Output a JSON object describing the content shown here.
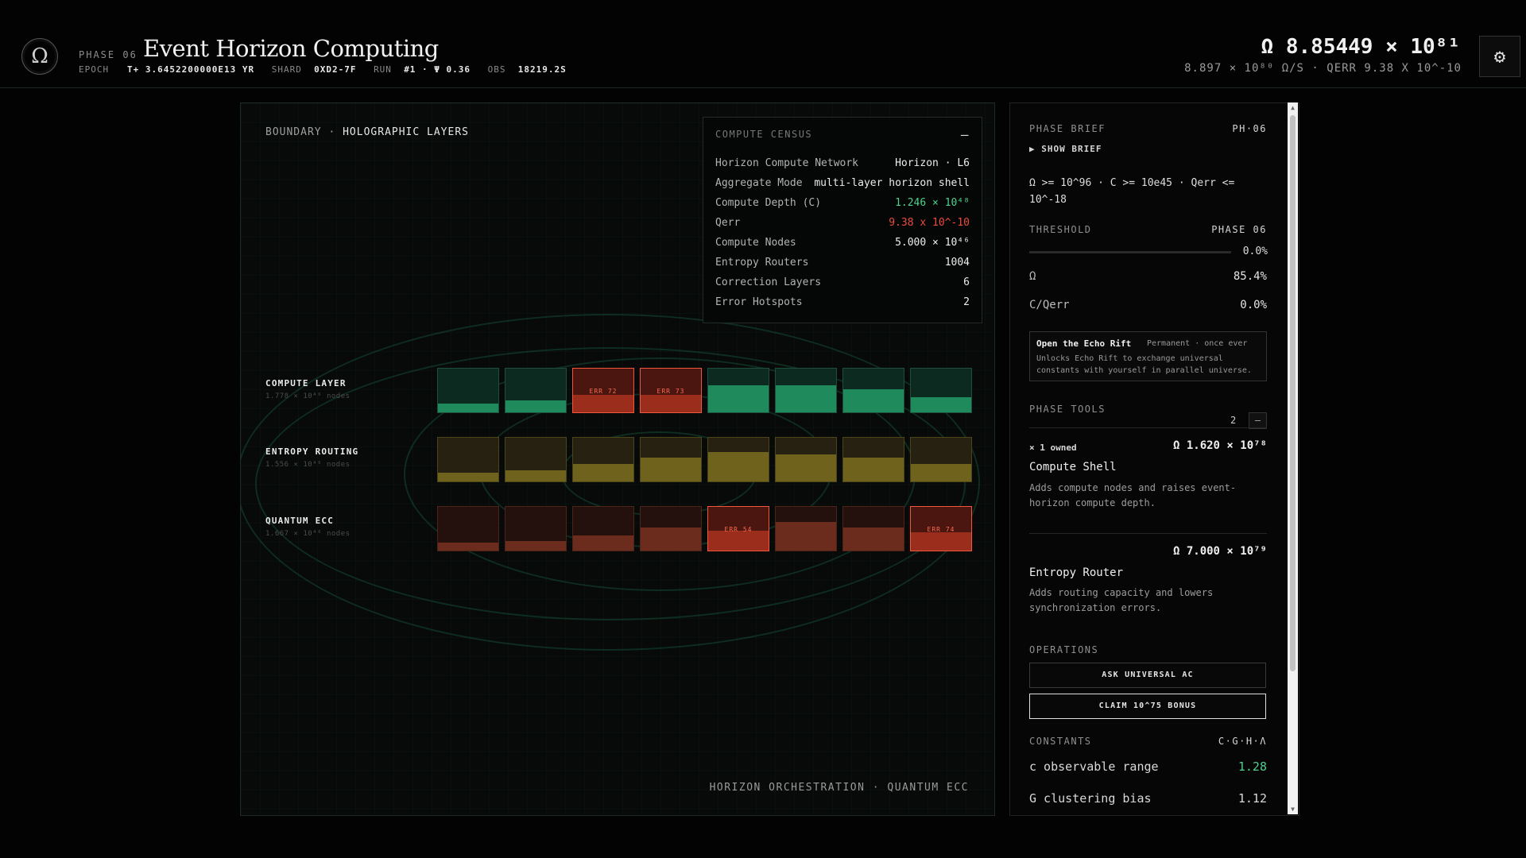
{
  "header": {
    "logo_glyph": "Ω",
    "phase_label": "PHASE 06",
    "title": "Event Horizon Computing",
    "meta": {
      "epoch_label": "EPOCH",
      "epoch_value": "T+ 3.6452200000E13 YR",
      "shard_label": "SHARD",
      "shard_value": "0XD2-7F",
      "run_label": "RUN",
      "run_value": "#1 · Ψ 0.36",
      "obs_label": "OBS",
      "obs_value": "18219.2S"
    },
    "omega_total": "Ω 8.85449 × 10⁸¹",
    "omega_rate": "8.897 × 10⁸⁰ Ω/S · QERR 9.38 X 10^-10",
    "settings_icon": "gear-icon"
  },
  "main": {
    "boundary_prefix": "BOUNDARY ·",
    "boundary_title": "HOLOGRAPHIC LAYERS",
    "footer": "HORIZON ORCHESTRATION · QUANTUM ECC",
    "census": {
      "title": "COMPUTE CENSUS",
      "collapse": "–",
      "rows": [
        {
          "k": "Horizon Compute Network",
          "v": "Horizon · L6"
        },
        {
          "k": "Aggregate Mode",
          "v": "multi-layer horizon shell"
        },
        {
          "k": "Compute Depth (C)",
          "v": "1.246 × 10⁴⁸"
        },
        {
          "k": "Qerr",
          "v": "9.38 x 10^-10"
        },
        {
          "k": "Compute Nodes",
          "v": "5.000 × 10⁴⁶"
        },
        {
          "k": "Entropy Routers",
          "v": "1004"
        },
        {
          "k": "Correction Layers",
          "v": "6"
        },
        {
          "k": "Error Hotspots",
          "v": "2"
        }
      ]
    },
    "layers": [
      {
        "name": "COMPUTE LAYER",
        "sub": "1.778 × 10⁴⁶ nodes",
        "color": "#1f8a5b",
        "cells": [
          {
            "level": 0.2,
            "err": ""
          },
          {
            "level": 0.28,
            "err": ""
          },
          {
            "level": 0.4,
            "err": "ERR 72"
          },
          {
            "level": 0.4,
            "err": "ERR 73"
          },
          {
            "level": 0.62,
            "err": ""
          },
          {
            "level": 0.62,
            "err": ""
          },
          {
            "level": 0.52,
            "err": ""
          },
          {
            "level": 0.35,
            "err": ""
          }
        ]
      },
      {
        "name": "ENTROPY ROUTING",
        "sub": "1.556 × 10⁴⁶ nodes",
        "color": "#6f621d",
        "cells": [
          {
            "level": 0.2,
            "err": ""
          },
          {
            "level": 0.26,
            "err": ""
          },
          {
            "level": 0.4,
            "err": ""
          },
          {
            "level": 0.55,
            "err": ""
          },
          {
            "level": 0.68,
            "err": ""
          },
          {
            "level": 0.62,
            "err": ""
          },
          {
            "level": 0.55,
            "err": ""
          },
          {
            "level": 0.4,
            "err": ""
          }
        ]
      },
      {
        "name": "QUANTUM ECC",
        "sub": "1.667 × 10⁴⁶ nodes",
        "color": "#6b2b1d",
        "cells": [
          {
            "level": 0.18,
            "err": ""
          },
          {
            "level": 0.22,
            "err": ""
          },
          {
            "level": 0.35,
            "err": ""
          },
          {
            "level": 0.52,
            "err": ""
          },
          {
            "level": 0.45,
            "err": "ERR 54"
          },
          {
            "level": 0.65,
            "err": ""
          },
          {
            "level": 0.52,
            "err": ""
          },
          {
            "level": 0.42,
            "err": "ERR 74"
          }
        ]
      }
    ]
  },
  "side": {
    "brief_title": "PHASE BRIEF",
    "brief_code": "PH·06",
    "show_brief": "▶ SHOW BRIEF",
    "brief_text": "Ω >= 10^96 · C >= 10e45 · Qerr <= 10^-18",
    "threshold_label": "THRESHOLD",
    "threshold_phase": "PHASE 06",
    "threshold_pct": "0.0%",
    "threshold_progress": 0.0,
    "omega_label": "Ω",
    "omega_pct": "85.4%",
    "cq_label": "C/Qerr",
    "cq_pct": "0.0%",
    "echo": {
      "title": "Open the Echo Rift",
      "tag": "Permanent · once ever",
      "desc": "Unlocks Echo Rift to exchange universal constants with yourself in parallel universe."
    },
    "tools_label": "PHASE TOOLS",
    "tools_count": "2",
    "tools_min": "–",
    "tools": [
      {
        "owned": "× 1 owned",
        "cost": "Ω 1.620 × 10⁷⁸",
        "name": "Compute Shell",
        "desc": "Adds compute nodes and raises event-horizon compute depth."
      },
      {
        "owned": "",
        "cost": "Ω 7.000 × 10⁷⁹",
        "name": "Entropy Router",
        "desc": "Adds routing capacity and lowers synchronization errors."
      }
    ],
    "operations_label": "OPERATIONS",
    "op_ask": "ASK UNIVERSAL AC",
    "op_claim": "CLAIM 10^75 BONUS",
    "constants_label": "CONSTANTS",
    "constants_keys": "C·G·H·Λ",
    "constants": [
      {
        "k": "c observable range",
        "v": "1.28",
        "color": "#4fd08d"
      },
      {
        "k": "G clustering bias",
        "v": "1.12",
        "color": "#e6e6e6"
      }
    ]
  }
}
